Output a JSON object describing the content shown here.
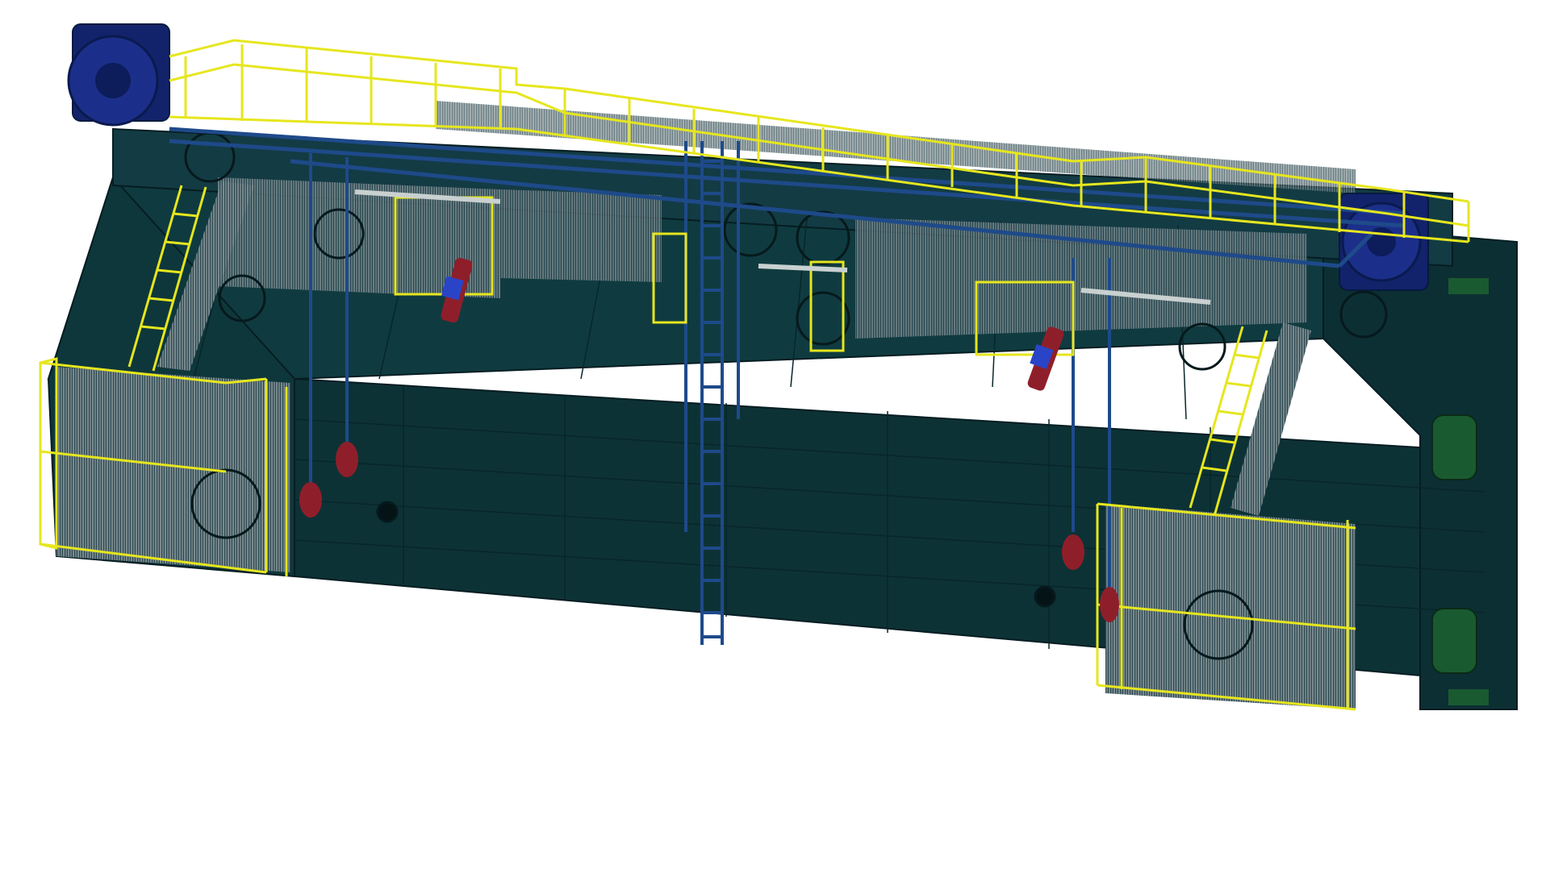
{
  "scene": {
    "background_color": "#ffffff",
    "body_color": "#0f3a3d",
    "body_dark_color": "#0b2f33",
    "edge_color": "#061d22",
    "railing_color": "#e6e61e",
    "steel_color": "#1e4a8a",
    "actuator_color": "#8e1f2a",
    "accent_color": "#2a44c8",
    "roller_color": "#1a5a30"
  },
  "components": {
    "body": "gate-body-icon",
    "walkway": "top-walkway-icon",
    "railing": "safety-railing-icon",
    "ladder": "access-ladder-icon",
    "stair": "stair-icon",
    "cage": "side-cage-icon",
    "actuator": "hydraulic-cylinder-icon",
    "hook": "counterweight-icon",
    "drum": "end-drum-icon",
    "wheel": "guide-wheel-icon"
  }
}
